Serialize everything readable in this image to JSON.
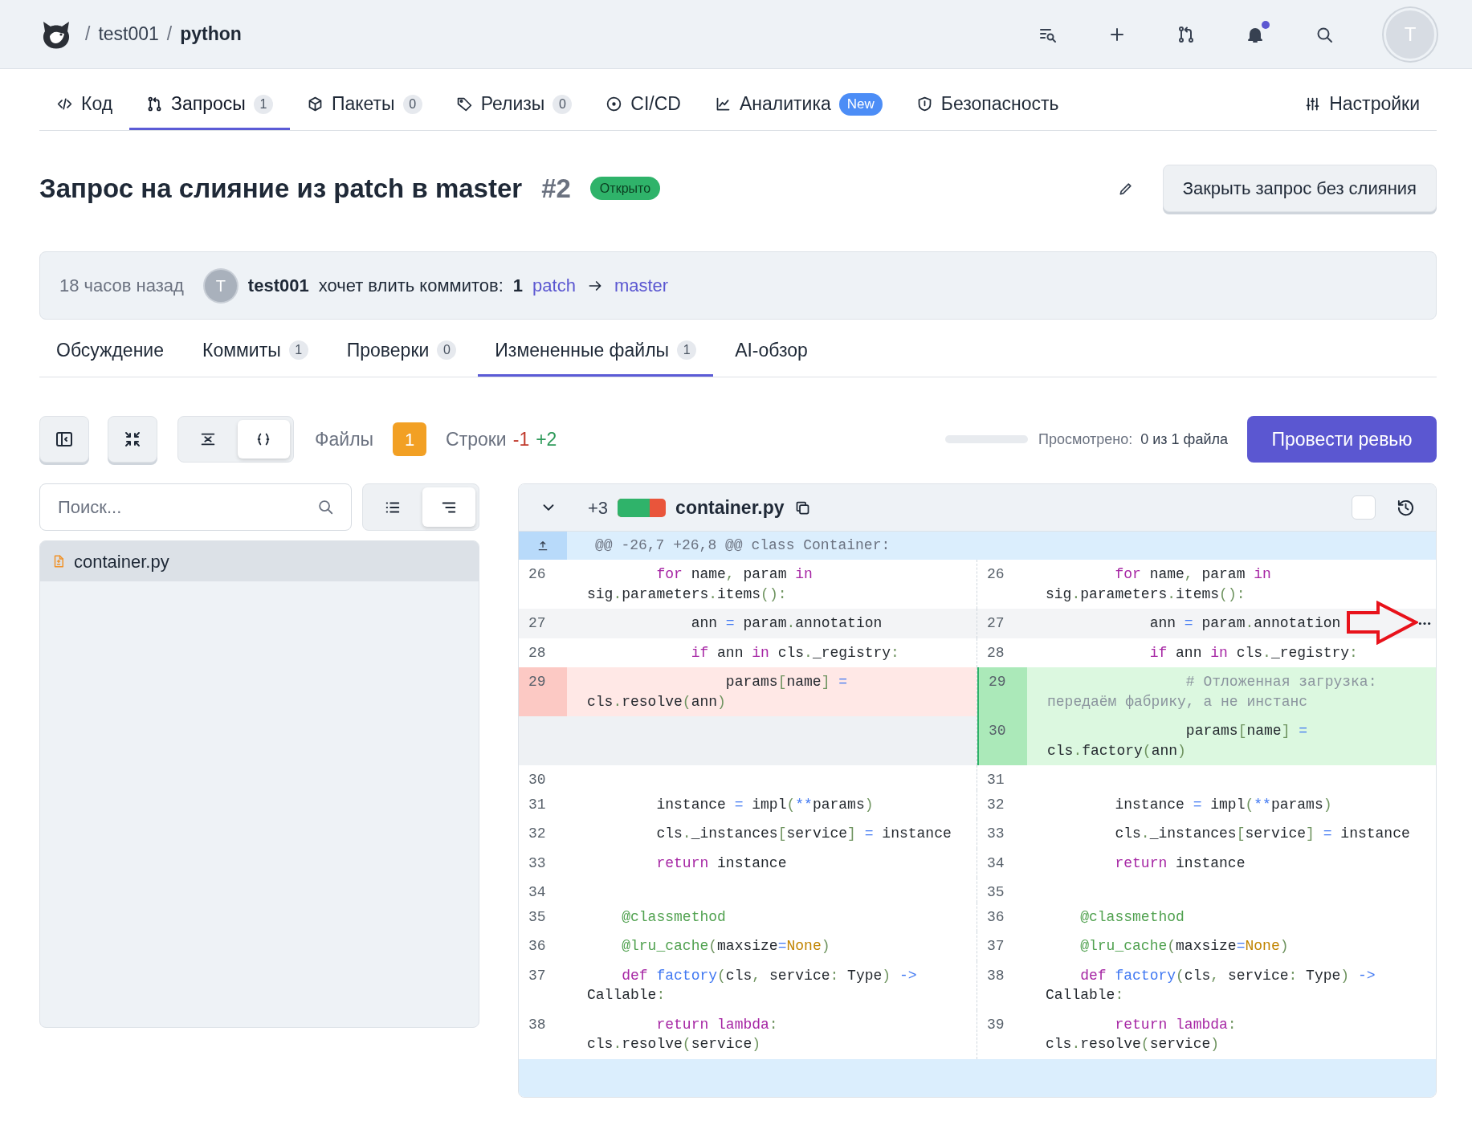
{
  "header": {
    "breadcrumb": [
      {
        "kind": "separator",
        "text": "/"
      },
      {
        "kind": "owner",
        "text": "test001"
      },
      {
        "kind": "separator",
        "text": "/"
      },
      {
        "kind": "repo",
        "text": "python"
      }
    ],
    "notifications": {
      "unread": true
    },
    "avatar_initial": "T"
  },
  "repo_tabs": [
    {
      "label": "Код",
      "selected": false
    },
    {
      "label": "Запросы",
      "count": "1",
      "selected": true
    },
    {
      "label": "Пакеты",
      "count": "0",
      "selected": false
    },
    {
      "label": "Релизы",
      "count": "0",
      "selected": false
    },
    {
      "label": "CI/CD",
      "selected": false
    },
    {
      "label": "Аналитика",
      "badge": "New",
      "selected": false
    },
    {
      "label": "Безопасность",
      "selected": false
    },
    {
      "label": "Настройки",
      "selected": false
    }
  ],
  "pull_request": {
    "title": "Запрос на слияние из patch в master",
    "number": "#2",
    "status": "Открыто",
    "close_button": "Закрыть запрос без слияния"
  },
  "summary": {
    "time": "18 часов назад",
    "avatar_initial": "T",
    "author": "test001",
    "action": "хочет влить коммитов:",
    "commit_count": "1",
    "source_branch": "patch",
    "target_branch": "master"
  },
  "pr_tabs": [
    {
      "label": "Обсуждение",
      "selected": false
    },
    {
      "label": "Коммиты",
      "count": "1",
      "selected": false
    },
    {
      "label": "Проверки",
      "count": "0",
      "selected": false
    },
    {
      "label": "Измененные файлы",
      "count": "1",
      "selected": true
    },
    {
      "label": "AI-обзор",
      "selected": false
    }
  ],
  "toolbar": {
    "diff_modes": [
      {
        "selected": false
      },
      {
        "selected": true
      }
    ],
    "files_label": "Файлы",
    "files_count": "1",
    "lines_label": "Строки",
    "deleted": "-1",
    "added": "+2",
    "viewed_progress": {
      "level": 0
    },
    "viewed_label": "Просмотрено:",
    "viewed_value": "0 из 1 файла",
    "review_button": "Провести ревью"
  },
  "file_tree": {
    "search_placeholder": "Поиск...",
    "view_modes": [
      {
        "selected": false
      },
      {
        "selected": true
      }
    ],
    "files": [
      {
        "name": "container.py",
        "selected": true
      }
    ]
  },
  "diff": {
    "file": {
      "name": "container.py",
      "expanded": true,
      "added_count": "+3",
      "change_bar": {
        "level": 0.67
      },
      "viewed": false
    },
    "hunk_header": "@@ -26,7 +26,8 @@ class Container:",
    "rows": [
      {
        "kind": "context",
        "hovered": false,
        "left": {
          "number": "26",
          "tokens": [
            {
              "kind": "keyword",
              "text": "        for"
            },
            {
              "kind": "plain",
              "text": " name"
            },
            {
              "kind": "punct",
              "text": ","
            },
            {
              "kind": "plain",
              "text": " param "
            },
            {
              "kind": "keyword",
              "text": "in"
            },
            {
              "kind": "plain",
              "text": " sig"
            },
            {
              "kind": "punct",
              "text": "."
            },
            {
              "kind": "plain",
              "text": "parameters"
            },
            {
              "kind": "punct",
              "text": "."
            },
            {
              "kind": "plain",
              "text": "items"
            },
            {
              "kind": "punct",
              "text": "():"
            }
          ]
        },
        "right": {
          "number": "26",
          "tokens": [
            {
              "kind": "keyword",
              "text": "        for"
            },
            {
              "kind": "plain",
              "text": " name"
            },
            {
              "kind": "punct",
              "text": ","
            },
            {
              "kind": "plain",
              "text": " param "
            },
            {
              "kind": "keyword",
              "text": "in"
            },
            {
              "kind": "plain",
              "text": " sig"
            },
            {
              "kind": "punct",
              "text": "."
            },
            {
              "kind": "plain",
              "text": "parameters"
            },
            {
              "kind": "punct",
              "text": "."
            },
            {
              "kind": "plain",
              "text": "items"
            },
            {
              "kind": "punct",
              "text": "():"
            }
          ]
        }
      },
      {
        "kind": "context",
        "hovered": true,
        "left": {
          "number": "27",
          "tokens": [
            {
              "kind": "plain",
              "text": "            ann "
            },
            {
              "kind": "operator",
              "text": "="
            },
            {
              "kind": "plain",
              "text": " param"
            },
            {
              "kind": "punct",
              "text": "."
            },
            {
              "kind": "plain",
              "text": "annotation"
            }
          ]
        },
        "right": {
          "number": "27",
          "tokens": [
            {
              "kind": "plain",
              "text": "            ann "
            },
            {
              "kind": "operator",
              "text": "="
            },
            {
              "kind": "plain",
              "text": " param"
            },
            {
              "kind": "punct",
              "text": "."
            },
            {
              "kind": "plain",
              "text": "annotation"
            }
          ]
        }
      },
      {
        "kind": "context",
        "hovered": false,
        "left": {
          "number": "28",
          "tokens": [
            {
              "kind": "keyword",
              "text": "            if"
            },
            {
              "kind": "plain",
              "text": " ann "
            },
            {
              "kind": "keyword",
              "text": "in"
            },
            {
              "kind": "plain",
              "text": " cls"
            },
            {
              "kind": "punct",
              "text": "."
            },
            {
              "kind": "plain",
              "text": "_registry"
            },
            {
              "kind": "punct",
              "text": ":"
            }
          ]
        },
        "right": {
          "number": "28",
          "tokens": [
            {
              "kind": "keyword",
              "text": "            if"
            },
            {
              "kind": "plain",
              "text": " ann "
            },
            {
              "kind": "keyword",
              "text": "in"
            },
            {
              "kind": "plain",
              "text": " cls"
            },
            {
              "kind": "punct",
              "text": "."
            },
            {
              "kind": "plain",
              "text": "_registry"
            },
            {
              "kind": "punct",
              "text": ":"
            }
          ]
        }
      },
      {
        "kind": "change",
        "removed": [
          {
            "number": "29",
            "tokens": [
              {
                "kind": "plain",
                "text": "                params"
              },
              {
                "kind": "punct",
                "text": "["
              },
              {
                "kind": "plain",
                "text": "name"
              },
              {
                "kind": "punct",
                "text": "]"
              },
              {
                "kind": "operator",
                "text": " ="
              },
              {
                "kind": "plain",
                "text": " cls"
              },
              {
                "kind": "punct",
                "text": "."
              },
              {
                "kind": "plain",
                "text": "resolve"
              },
              {
                "kind": "punct",
                "text": "("
              },
              {
                "kind": "plain",
                "text": "ann"
              },
              {
                "kind": "punct",
                "text": ")"
              }
            ]
          }
        ],
        "added": [
          {
            "number": "29",
            "tokens": [
              {
                "kind": "comment",
                "text": "                # Отложенная загрузка: передаём фабрику, а не инстанс"
              }
            ]
          },
          {
            "number": "30",
            "tokens": [
              {
                "kind": "plain",
                "text": "                params"
              },
              {
                "kind": "punct",
                "text": "["
              },
              {
                "kind": "plain",
                "text": "name"
              },
              {
                "kind": "punct",
                "text": "]"
              },
              {
                "kind": "operator",
                "text": " ="
              },
              {
                "kind": "plain",
                "text": " cls"
              },
              {
                "kind": "punct",
                "text": "."
              },
              {
                "kind": "plain",
                "text": "factory"
              },
              {
                "kind": "punct",
                "text": "("
              },
              {
                "kind": "plain",
                "text": "ann"
              },
              {
                "kind": "punct",
                "text": ")"
              }
            ]
          }
        ]
      },
      {
        "kind": "context",
        "hovered": false,
        "left": {
          "number": "30"
        },
        "right": {
          "number": "31"
        }
      },
      {
        "kind": "context",
        "hovered": false,
        "left": {
          "number": "31",
          "tokens": [
            {
              "kind": "plain",
              "text": "        instance "
            },
            {
              "kind": "operator",
              "text": "="
            },
            {
              "kind": "plain",
              "text": " impl"
            },
            {
              "kind": "punct",
              "text": "("
            },
            {
              "kind": "operator",
              "text": "**"
            },
            {
              "kind": "plain",
              "text": "params"
            },
            {
              "kind": "punct",
              "text": ")"
            }
          ]
        },
        "right": {
          "number": "32",
          "tokens": [
            {
              "kind": "plain",
              "text": "        instance "
            },
            {
              "kind": "operator",
              "text": "="
            },
            {
              "kind": "plain",
              "text": " impl"
            },
            {
              "kind": "punct",
              "text": "("
            },
            {
              "kind": "operator",
              "text": "**"
            },
            {
              "kind": "plain",
              "text": "params"
            },
            {
              "kind": "punct",
              "text": ")"
            }
          ]
        }
      },
      {
        "kind": "context",
        "hovered": false,
        "left": {
          "number": "32",
          "tokens": [
            {
              "kind": "plain",
              "text": "        cls"
            },
            {
              "kind": "punct",
              "text": "."
            },
            {
              "kind": "plain",
              "text": "_instances"
            },
            {
              "kind": "punct",
              "text": "["
            },
            {
              "kind": "plain",
              "text": "service"
            },
            {
              "kind": "punct",
              "text": "]"
            },
            {
              "kind": "operator",
              "text": " ="
            },
            {
              "kind": "plain",
              "text": " instance"
            }
          ]
        },
        "right": {
          "number": "33",
          "tokens": [
            {
              "kind": "plain",
              "text": "        cls"
            },
            {
              "kind": "punct",
              "text": "."
            },
            {
              "kind": "plain",
              "text": "_instances"
            },
            {
              "kind": "punct",
              "text": "["
            },
            {
              "kind": "plain",
              "text": "service"
            },
            {
              "kind": "punct",
              "text": "]"
            },
            {
              "kind": "operator",
              "text": " ="
            },
            {
              "kind": "plain",
              "text": " instance"
            }
          ]
        }
      },
      {
        "kind": "context",
        "hovered": false,
        "left": {
          "number": "33",
          "tokens": [
            {
              "kind": "keyword",
              "text": "        return"
            },
            {
              "kind": "plain",
              "text": " instance"
            }
          ]
        },
        "right": {
          "number": "34",
          "tokens": [
            {
              "kind": "keyword",
              "text": "        return"
            },
            {
              "kind": "plain",
              "text": " instance"
            }
          ]
        }
      },
      {
        "kind": "context",
        "hovered": false,
        "left": {
          "number": "34"
        },
        "right": {
          "number": "35"
        }
      },
      {
        "kind": "context",
        "hovered": false,
        "left": {
          "number": "35",
          "tokens": [
            {
              "kind": "decorator",
              "text": "    @classmethod"
            }
          ]
        },
        "right": {
          "number": "36",
          "tokens": [
            {
              "kind": "decorator",
              "text": "    @classmethod"
            }
          ]
        }
      },
      {
        "kind": "context",
        "hovered": false,
        "left": {
          "number": "36",
          "tokens": [
            {
              "kind": "decorator",
              "text": "    @lru_cache"
            },
            {
              "kind": "punct",
              "text": "("
            },
            {
              "kind": "plain",
              "text": "maxsize"
            },
            {
              "kind": "operator",
              "text": "="
            },
            {
              "kind": "constant",
              "text": "None"
            },
            {
              "kind": "punct",
              "text": ")"
            }
          ]
        },
        "right": {
          "number": "37",
          "tokens": [
            {
              "kind": "decorator",
              "text": "    @lru_cache"
            },
            {
              "kind": "punct",
              "text": "("
            },
            {
              "kind": "plain",
              "text": "maxsize"
            },
            {
              "kind": "operator",
              "text": "="
            },
            {
              "kind": "constant",
              "text": "None"
            },
            {
              "kind": "punct",
              "text": ")"
            }
          ]
        }
      },
      {
        "kind": "context",
        "hovered": false,
        "left": {
          "number": "37",
          "tokens": [
            {
              "kind": "keyword",
              "text": "    def"
            },
            {
              "kind": "function",
              "text": " factory"
            },
            {
              "kind": "punct",
              "text": "("
            },
            {
              "kind": "plain",
              "text": "cls"
            },
            {
              "kind": "punct",
              "text": ","
            },
            {
              "kind": "plain",
              "text": " service"
            },
            {
              "kind": "punct",
              "text": ":"
            },
            {
              "kind": "plain",
              "text": " Type"
            },
            {
              "kind": "punct",
              "text": ")"
            },
            {
              "kind": "operator",
              "text": " ->"
            },
            {
              "kind": "plain",
              "text": " Callable"
            },
            {
              "kind": "punct",
              "text": ":"
            }
          ]
        },
        "right": {
          "number": "38",
          "tokens": [
            {
              "kind": "keyword",
              "text": "    def"
            },
            {
              "kind": "function",
              "text": " factory"
            },
            {
              "kind": "punct",
              "text": "("
            },
            {
              "kind": "plain",
              "text": "cls"
            },
            {
              "kind": "punct",
              "text": ","
            },
            {
              "kind": "plain",
              "text": " service"
            },
            {
              "kind": "punct",
              "text": ":"
            },
            {
              "kind": "plain",
              "text": " Type"
            },
            {
              "kind": "punct",
              "text": ")"
            },
            {
              "kind": "operator",
              "text": " ->"
            },
            {
              "kind": "plain",
              "text": " Callable"
            },
            {
              "kind": "punct",
              "text": ":"
            }
          ]
        }
      },
      {
        "kind": "context",
        "hovered": false,
        "left": {
          "number": "38",
          "tokens": [
            {
              "kind": "keyword",
              "text": "        return"
            },
            {
              "kind": "keyword",
              "text": " lambda"
            },
            {
              "kind": "punct",
              "text": ":"
            },
            {
              "kind": "plain",
              "text": " cls"
            },
            {
              "kind": "punct",
              "text": "."
            },
            {
              "kind": "plain",
              "text": "resolve"
            },
            {
              "kind": "punct",
              "text": "("
            },
            {
              "kind": "plain",
              "text": "service"
            },
            {
              "kind": "punct",
              "text": ")"
            }
          ]
        },
        "right": {
          "number": "39",
          "tokens": [
            {
              "kind": "keyword",
              "text": "        return"
            },
            {
              "kind": "keyword",
              "text": " lambda"
            },
            {
              "kind": "punct",
              "text": ":"
            },
            {
              "kind": "plain",
              "text": " cls"
            },
            {
              "kind": "punct",
              "text": "."
            },
            {
              "kind": "plain",
              "text": "resolve"
            },
            {
              "kind": "punct",
              "text": "("
            },
            {
              "kind": "plain",
              "text": "service"
            },
            {
              "kind": "punct",
              "text": ")"
            }
          ]
        }
      }
    ]
  }
}
